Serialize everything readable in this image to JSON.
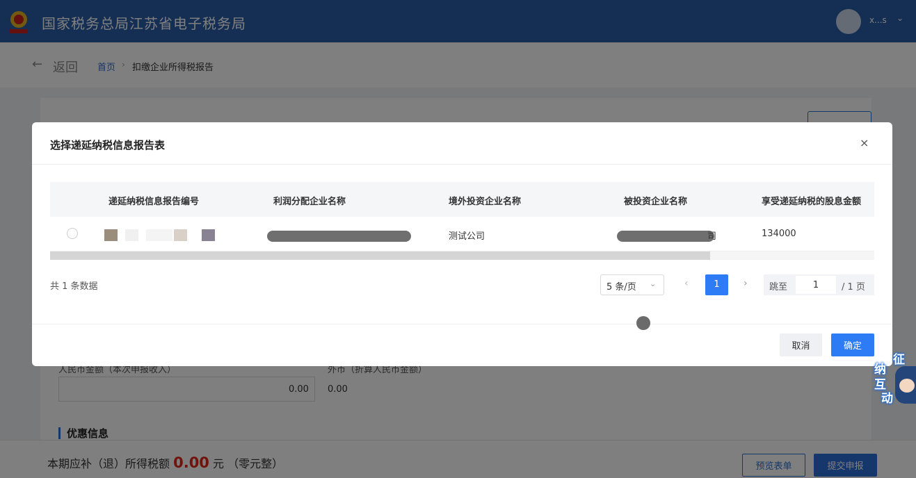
{
  "header": {
    "title": "国家税务总局江苏省电子税务局",
    "user_name": "x...s",
    "brand_color": "#2a5ea8"
  },
  "breadcrumb": {
    "back_label": "返回",
    "home": "首页",
    "separator": "›",
    "current": "扣缴企业所得税报告"
  },
  "background_form": {
    "rmb_label": "人民币金额（本次申报收入）",
    "foreign_label": "外币（折算人民币金额）",
    "rmb_amount": "0.00",
    "foreign_amount": "0.00",
    "section_title": "优惠信息"
  },
  "footer": {
    "prefix": "本期应补（退）所得税额",
    "amount": "0.00",
    "unit": "元",
    "amount_in_words": "（零元整）",
    "preview_label": "预览表单",
    "submit_label": "提交申报"
  },
  "dialog": {
    "title": "选择递延纳税信息报告表",
    "close_glyph": "×",
    "columns": [
      "递延纳税信息报告编号",
      "利润分配企业名称",
      "境外投资企业名称",
      "被投资企业名称",
      "享受递延纳税的股息金额"
    ],
    "rows": [
      {
        "report_no": "",
        "profit_distributor": "",
        "overseas_investor": "测试公司",
        "investee": "",
        "investee_suffix": "司",
        "dividend_amount": "134000"
      }
    ],
    "total_text": "共 1 条数据",
    "page_size": "5 条/页",
    "current_page": "1",
    "jump_label": "跳至",
    "jump_value": "1",
    "total_pages": "/ 1 页",
    "cancel_label": "取消",
    "confirm_label": "确定",
    "accent_color": "#2d7cf6"
  },
  "assistant": {
    "chars": [
      "征",
      "纳",
      "互",
      "动"
    ]
  }
}
